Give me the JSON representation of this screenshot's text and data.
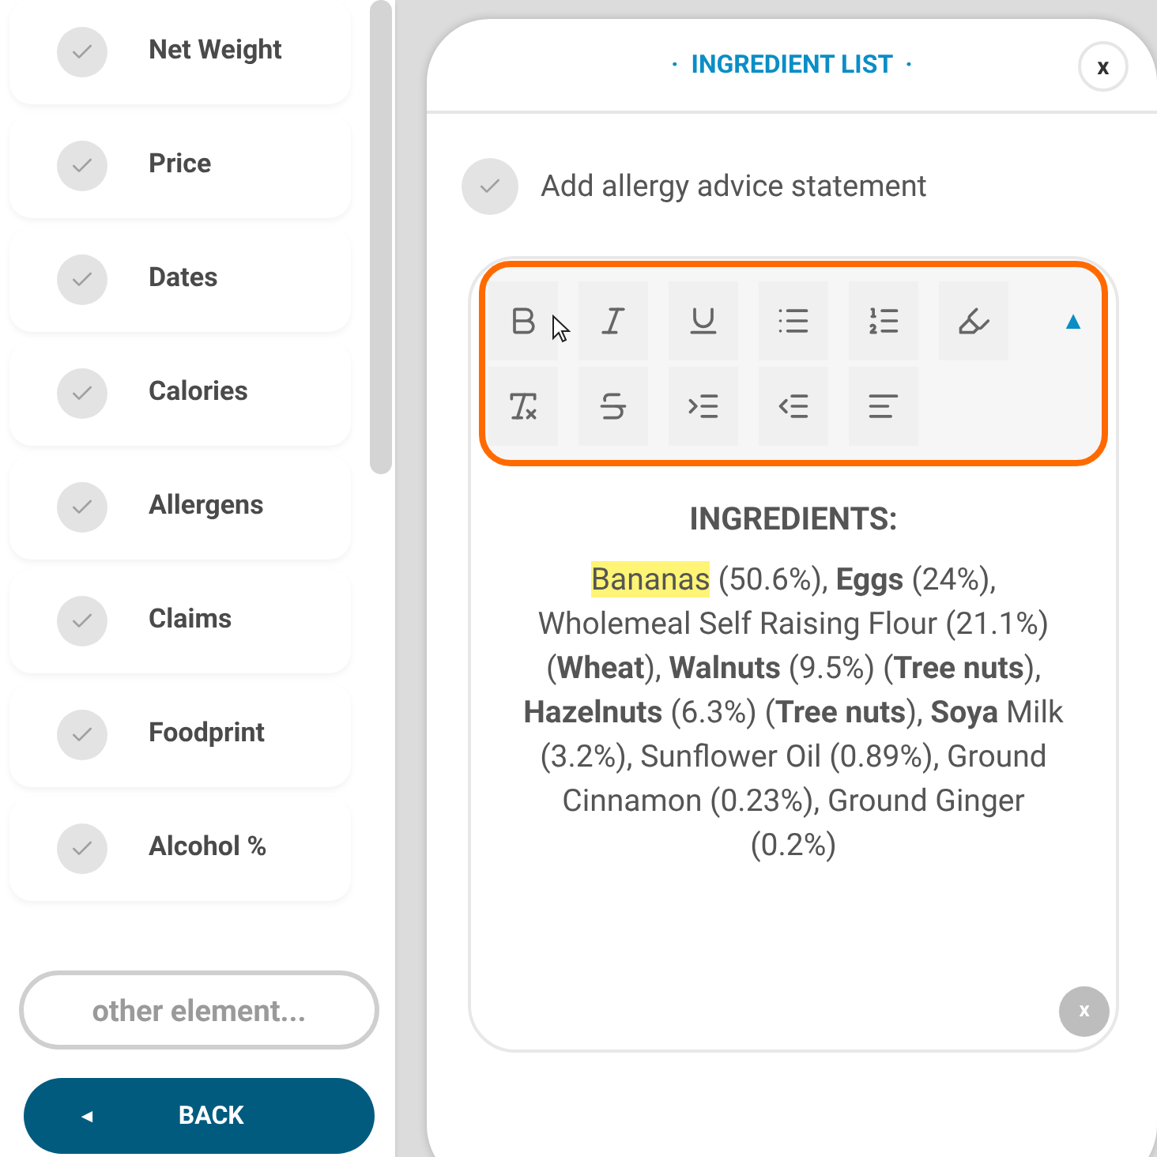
{
  "sidebar": {
    "items": [
      {
        "label": "Net Weight",
        "checked": false
      },
      {
        "label": "Price",
        "checked": false
      },
      {
        "label": "Dates",
        "checked": false
      },
      {
        "label": "Calories",
        "checked": false
      },
      {
        "label": "Allergens",
        "checked": false
      },
      {
        "label": "Claims",
        "checked": false
      },
      {
        "label": "Foodprint",
        "checked": false
      },
      {
        "label": "Alcohol %",
        "checked": false
      }
    ],
    "search": {
      "placeholder": "other element..."
    },
    "back_button": {
      "icon": "◄",
      "label": "BACK"
    }
  },
  "panel": {
    "title": "·  INGREDIENT LIST  ·",
    "close": "x",
    "allergy_option": {
      "label": "Add allergy advice statement",
      "checked": false
    },
    "toolbar": {
      "rows": [
        [
          {
            "kind": "bold"
          },
          {
            "kind": "italic"
          },
          {
            "kind": "underline"
          },
          {
            "kind": "bullet-list"
          },
          {
            "kind": "numbered-list"
          },
          {
            "kind": "highlight"
          }
        ],
        [
          {
            "kind": "clear-format"
          },
          {
            "kind": "strikethrough"
          },
          {
            "kind": "indent"
          },
          {
            "kind": "outdent"
          },
          {
            "kind": "align"
          }
        ]
      ],
      "collapse": "▲"
    },
    "heading": "INGREDIENTS:",
    "text": [
      {
        "text": "Bananas",
        "highlighted": true
      },
      {
        "text": " (50.6%), **Eggs** (24%), Wholemeal Self Raising Flour (21.1%) (**Wheat**), **Walnuts** (9.5%) (**Tree nuts**), **Hazelnuts** (6.3%) (**Tree nuts**), **Soya** Milk (3.2%), Sunflower Oil (0.89%), Ground Cinnamon (0.23%), Ground Ginger (0.2%)",
        "highlighted": false
      }
    ],
    "clear": "x"
  }
}
